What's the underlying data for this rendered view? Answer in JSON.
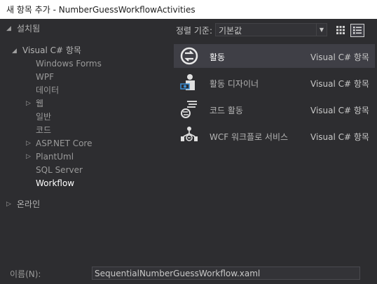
{
  "window": {
    "title": "새 항목 추가 - NumberGuessWorkflowActivities"
  },
  "tree": {
    "installed": "설치됨",
    "visual_cs": "Visual C# 항목",
    "children": [
      "Windows Forms",
      "WPF",
      "데이터",
      "웹",
      "일반",
      "코드",
      "ASP.NET Core",
      "PlantUml",
      "SQL Server",
      "Workflow"
    ],
    "online": "온라인",
    "selected": "Workflow"
  },
  "sort": {
    "label": "정렬 기준:",
    "value": "기본값"
  },
  "items": [
    {
      "name": "활동",
      "type": "Visual C# 항목",
      "icon": "activity-icon",
      "selected": true
    },
    {
      "name": "활동 디자이너",
      "type": "Visual C# 항목",
      "icon": "activity-designer-icon",
      "selected": false
    },
    {
      "name": "코드 활동",
      "type": "Visual C# 항목",
      "icon": "code-activity-icon",
      "selected": false
    },
    {
      "name": "WCF 워크플로 서비스",
      "type": "Visual C# 항목",
      "icon": "wcf-workflow-service-icon",
      "selected": false
    }
  ],
  "name_field": {
    "label": "이름(N):",
    "value": "SequentialNumberGuessWorkflow.xaml"
  }
}
